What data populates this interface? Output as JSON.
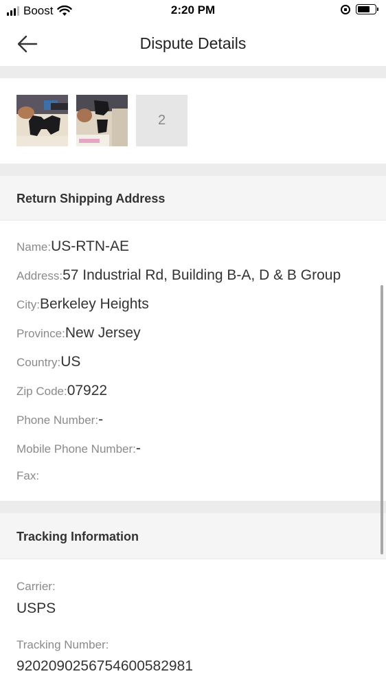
{
  "status": {
    "carrier": "Boost",
    "time": "2:20 PM"
  },
  "nav": {
    "title": "Dispute Details"
  },
  "images": {
    "more_count": "2"
  },
  "return_address": {
    "header": "Return Shipping Address",
    "fields": [
      {
        "label": "Name: ",
        "value": "US-RTN-AE"
      },
      {
        "label": "Address:",
        "value": "57 Industrial Rd, Building B-A, D & B Group"
      },
      {
        "label": "City: ",
        "value": "Berkeley Heights"
      },
      {
        "label": "Province: ",
        "value": "New Jersey"
      },
      {
        "label": "Country: ",
        "value": "US"
      },
      {
        "label": "Zip Code: ",
        "value": "07922"
      },
      {
        "label": "Phone Number: ",
        "value": "-"
      },
      {
        "label": "Mobile Phone Number: ",
        "value": "-"
      },
      {
        "label": "Fax:",
        "value": ""
      }
    ]
  },
  "tracking": {
    "header": "Tracking Information",
    "carrier_label": "Carrier:",
    "carrier_value": "USPS",
    "number_label": "Tracking Number:",
    "number_value": "9202090256754600582981"
  }
}
